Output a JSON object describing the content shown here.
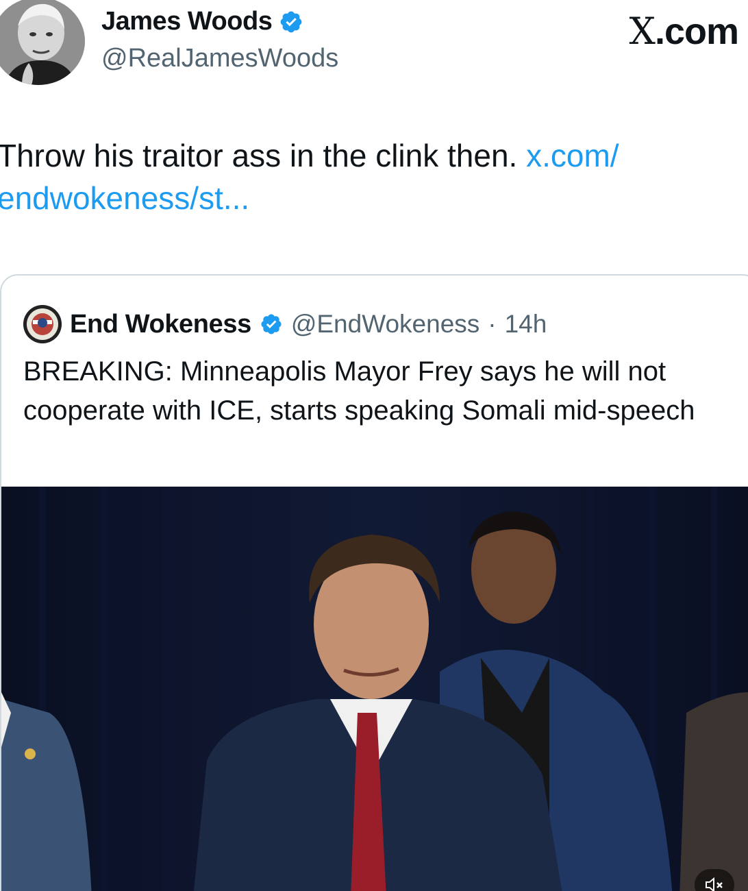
{
  "author": {
    "name": "James Woods",
    "handle": "@RealJamesWoods",
    "verified": true,
    "avatar_icon": "portrait-avatar-icon"
  },
  "brand": {
    "x_mark": "X",
    "suffix": ".com"
  },
  "tweet": {
    "text": "Throw his traitor ass in the clink then. ",
    "link_text": "x.com/\nendwokeness/st..."
  },
  "quoted": {
    "name": "End Wokeness",
    "handle": "@EndWokeness",
    "separator": "·",
    "time": "14h",
    "text": "BREAKING: Minneapolis Mayor Frey says he will not cooperate with ICE, starts speaking Somali mid-speech",
    "media_icon": "video-thumbnail-icon",
    "mute_icon": "volume-muted-icon"
  },
  "colors": {
    "link": "#1d9bf0",
    "verified": "#1d9bf0",
    "secondary_text": "#536471",
    "border": "#cfd9de"
  }
}
